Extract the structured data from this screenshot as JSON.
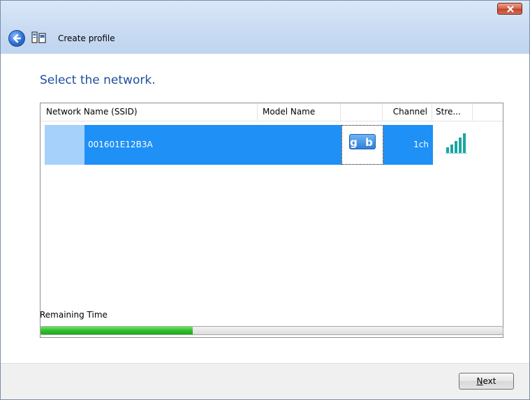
{
  "window": {
    "title": "Create profile",
    "close_label": "x"
  },
  "main": {
    "heading": "Select the network."
  },
  "network_list": {
    "columns": [
      "Network Name (SSID)",
      "Model Name",
      "",
      "Channel",
      "Stre..."
    ],
    "rows": [
      {
        "ssid": "001601E12B3A",
        "model_name": "",
        "model_icon": "gb-icon",
        "channel": "1ch",
        "strength_icon": "signal-strength-icon",
        "signal_bars_of_5": 5
      }
    ]
  },
  "remaining": {
    "label": "Remaining Time",
    "progress_fraction": 0.33
  },
  "footer": {
    "next_mnemonic": "N",
    "next_rest": "ext"
  },
  "colors": {
    "selection": "#1e90f6",
    "heading": "#1e4e9b",
    "progress": "#2fbf2a",
    "signal": "#1aa6a0"
  }
}
